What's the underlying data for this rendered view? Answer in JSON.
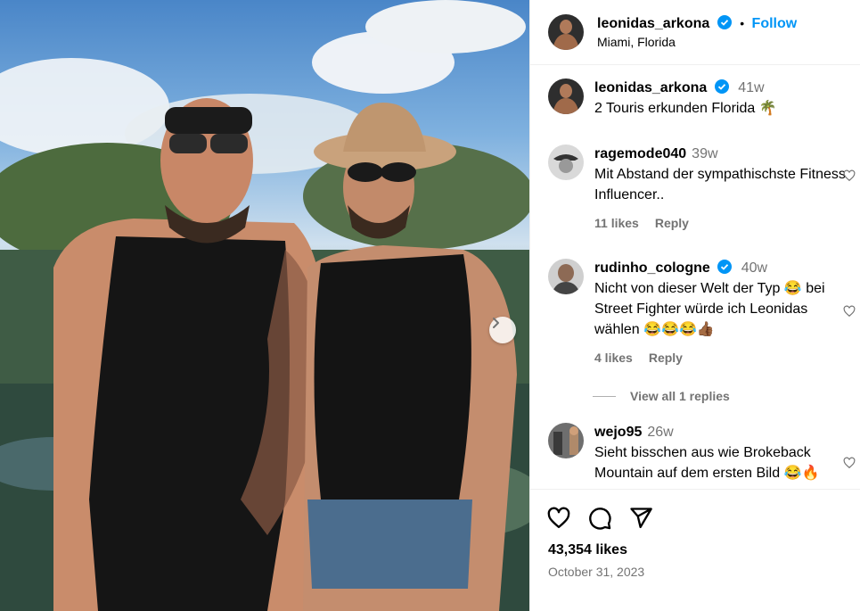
{
  "post": {
    "username": "leonidas_arkona",
    "follow_label": "Follow",
    "location": "Miami, Florida",
    "caption": {
      "username": "leonidas_arkona",
      "time": "41w",
      "text": "2 Touris erkunden Florida 🌴"
    },
    "likes": "43,354 likes",
    "date": "October 31, 2023"
  },
  "comments": [
    {
      "username": "ragemode040",
      "time": "39w",
      "text": "Mit Abstand der sympathischste Fitness Influencer..",
      "likes": "11 likes",
      "reply_label": "Reply"
    },
    {
      "username": "rudinho_cologne",
      "time": "40w",
      "text": "Nicht von dieser Welt der Typ 😂 bei Street Fighter würde ich Leonidas wählen 😂😂😂👍🏾",
      "likes": "4 likes",
      "reply_label": "Reply"
    },
    {
      "username": "wejo95",
      "time": "26w",
      "text": "Sieht bisschen aus wie Brokeback Mountain auf dem ersten Bild 😂🔥"
    }
  ],
  "view_replies_label": "View all 1 replies",
  "icons": {
    "verified": "verified-badge-icon",
    "like": "heart-icon",
    "comment": "comment-icon",
    "share": "send-icon",
    "next": "chevron-right-icon"
  },
  "colors": {
    "accent": "#0095f6",
    "muted": "#737373",
    "divider": "#efefef"
  }
}
